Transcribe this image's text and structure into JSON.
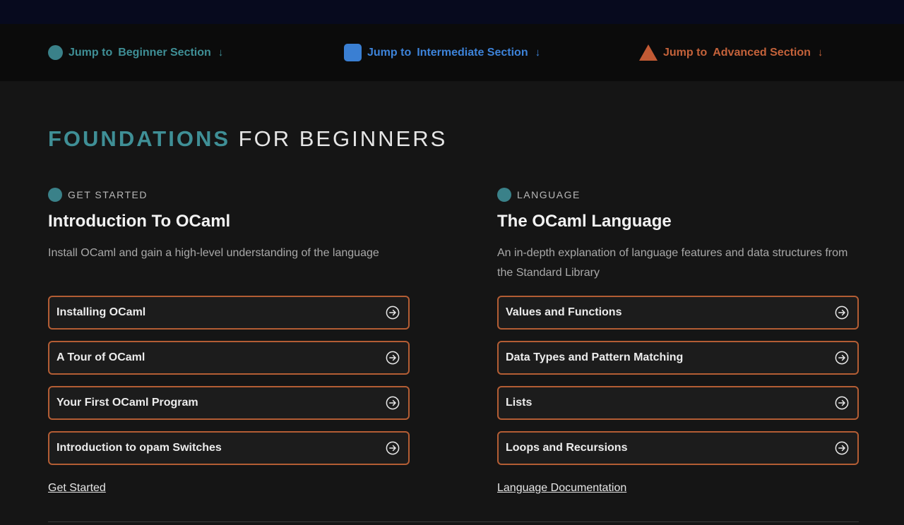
{
  "jump_nav": {
    "prefix": "Jump to",
    "arrow": "↓",
    "items": [
      {
        "label": "Beginner Section",
        "color": "#3f8f96"
      },
      {
        "label": "Intermediate Section",
        "color": "#3d83d9"
      },
      {
        "label": "Advanced Section",
        "color": "#c4623a"
      }
    ]
  },
  "section": {
    "title_accent": "FOUNDATIONS",
    "title_rest": "FOR BEGINNERS"
  },
  "columns": [
    {
      "eyebrow": "GET STARTED",
      "title": "Introduction To OCaml",
      "description": "Install OCaml and gain a high-level understanding of the language",
      "links": [
        {
          "label": "Installing OCaml"
        },
        {
          "label": "A Tour of OCaml"
        },
        {
          "label": "Your First OCaml Program"
        },
        {
          "label": "Introduction to opam Switches"
        }
      ],
      "footer_link": "Get Started"
    },
    {
      "eyebrow": "LANGUAGE",
      "title": "The OCaml Language",
      "description": "An in-depth explanation of language features and data structures from the Standard Library",
      "links": [
        {
          "label": "Values and Functions"
        },
        {
          "label": "Data Types and Pattern Matching"
        },
        {
          "label": "Lists"
        },
        {
          "label": "Loops and Recursions"
        }
      ],
      "footer_link": "Language Documentation"
    }
  ],
  "colors": {
    "beginner_accent": "#3f8f96",
    "card_border": "#b35d34",
    "background": "#151515"
  }
}
